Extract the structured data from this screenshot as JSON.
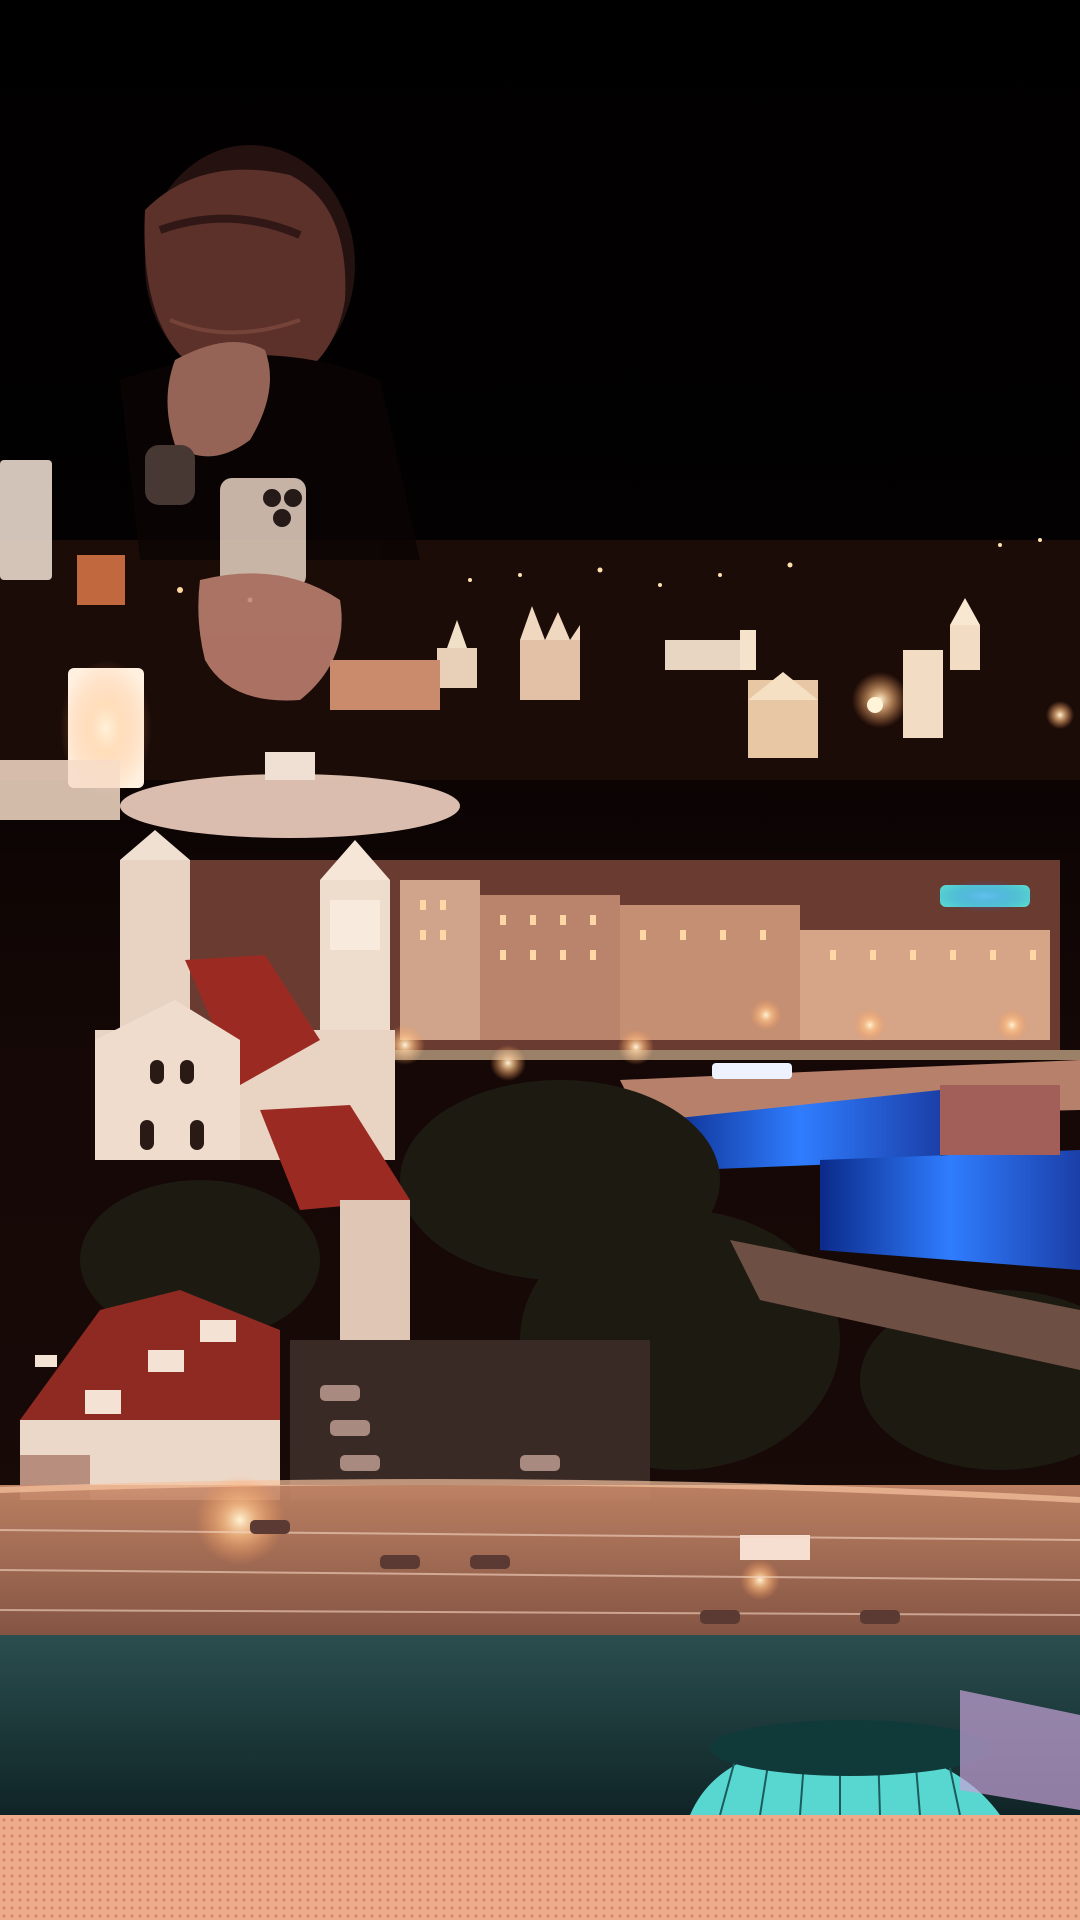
{
  "image": {
    "kind": "photograph",
    "subject": "night-city-window-reflection",
    "palette": {
      "sky": "#020101",
      "city_glow": "#f6b07a",
      "warm_light": "#ffd9a8",
      "roof_red": "#9b2b22",
      "facade": "#e9d3c3",
      "river_blue": "#2f7dff",
      "teal_glass": "#58d6d0",
      "sill_glow": "#f7b58e",
      "shadow": "#0a0405"
    }
  }
}
